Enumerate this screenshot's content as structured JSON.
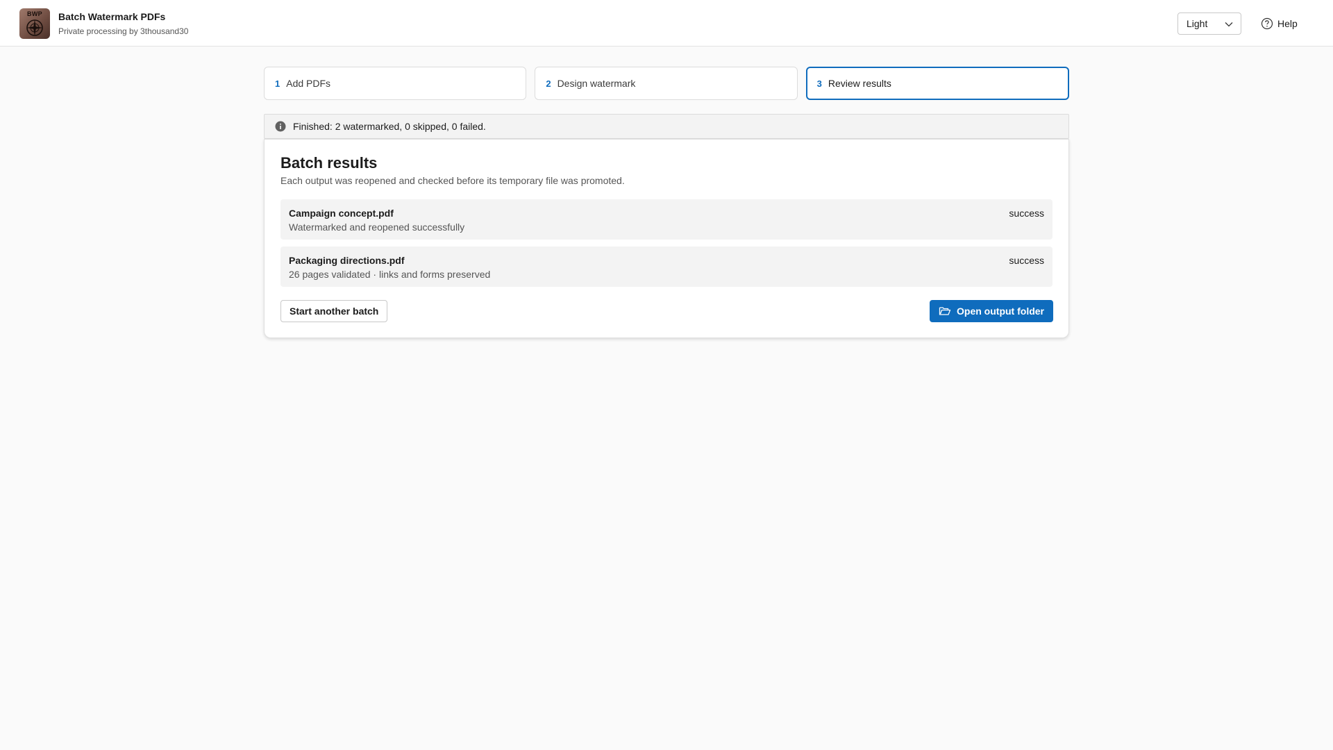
{
  "app": {
    "logo_text": "BWP",
    "title": "Batch Watermark PDFs",
    "subtitle": "Private processing by 3thousand30"
  },
  "header": {
    "theme_value": "Light",
    "help_label": "Help"
  },
  "steps": [
    {
      "number": "1",
      "label": "Add PDFs",
      "active": false
    },
    {
      "number": "2",
      "label": "Design watermark",
      "active": false
    },
    {
      "number": "3",
      "label": "Review results",
      "active": true
    }
  ],
  "status": {
    "message": "Finished: 2 watermarked, 0 skipped, 0 failed."
  },
  "results": {
    "title": "Batch results",
    "description": "Each output was reopened and checked before its temporary file was promoted.",
    "items": [
      {
        "name": "Campaign concept.pdf",
        "detail": "Watermarked and reopened successfully",
        "status": "success"
      },
      {
        "name": "Packaging directions.pdf",
        "detail": "26 pages validated · links and forms preserved",
        "status": "success"
      }
    ],
    "start_another_label": "Start another batch",
    "open_folder_label": "Open output folder"
  },
  "colors": {
    "accent": "#0f6cbd",
    "background": "#fafafa",
    "row_background": "#f3f3f3"
  },
  "icons": {
    "logo": "compass-logo-icon",
    "theme": "chevron-down-icon",
    "help": "question-circle-icon",
    "status": "info-icon",
    "folder": "folder-open-icon"
  }
}
